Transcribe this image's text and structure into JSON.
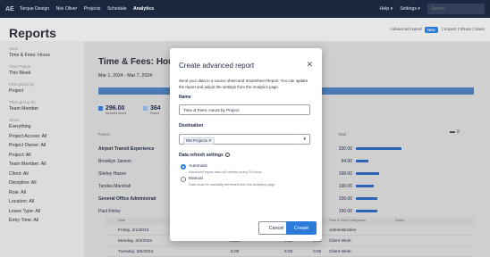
{
  "topnav": {
    "logo": "AE",
    "items": [
      "Torque Design",
      "Nivi Oliver",
      "Projects",
      "Schedule",
      "Analytics"
    ],
    "help": "Help ▾",
    "settings": "Settings ▾",
    "search_placeholder": "Search"
  },
  "page": {
    "title": "Reports",
    "advanced_report": "Advanced report",
    "new_badge": "New",
    "export": "Export",
    "share": "Share",
    "save": "Save"
  },
  "sidebar": {
    "view_label": "View",
    "view_value": "Time & Fees: Hours",
    "timeframe_label": "Time Frame",
    "timeframe_value": "This Week",
    "first_group_label": "First group by",
    "first_group_value": "Project",
    "then_group_label": "Then group by",
    "then_group_value": "Team Member",
    "show_label": "Show",
    "filters": [
      "Everything",
      "Project Access: All",
      "Project Owner: All",
      "Project: All",
      "Team Member: All",
      "Client: All",
      "Discipline: All",
      "Role: All",
      "Location: All",
      "Leave Type: All",
      "Entry Time: All"
    ]
  },
  "report": {
    "title": "Time & Fees: Hou",
    "date_range": "Mar 1, 2024 - Mar 7, 2024",
    "kpi1_value": "296.00",
    "kpi1_label": "Incurred hours",
    "kpi2_value": "364",
    "kpi2_label": "Future",
    "col_project": "Project",
    "col_total": "Total",
    "rows": [
      {
        "name": "Airport Transit Experience",
        "total": "330.00",
        "bold": true,
        "bar": 0.85
      },
      {
        "name": "Brooklyn Janson",
        "total": "94.00",
        "bold": false,
        "bar": 0.24
      },
      {
        "name": "Shirley Hason",
        "total": "168.00",
        "bold": false,
        "bar": 0.43
      },
      {
        "name": "Tamika Marshall",
        "total": "130.00",
        "bold": false,
        "bar": 0.33
      },
      {
        "name": "General Office Administrati",
        "total": "156.00",
        "bold": true,
        "bar": 0.4
      },
      {
        "name": "Paul Finley",
        "total": "156.00",
        "bold": false,
        "bar": 0.4
      }
    ],
    "detail_headers": [
      "Date",
      "Time & Fees Categories",
      "Notes"
    ],
    "detail_rows": [
      {
        "date": "Friday, 3/1/2024",
        "a": "4.00",
        "b": "4.00",
        "c": "0.00",
        "cat": "Administrative"
      },
      {
        "date": "Monday, 3/4/2024",
        "a": "8.00",
        "b": "8.00",
        "c": "0.00",
        "cat": "Client Work"
      },
      {
        "date": "Tuesday, 3/5/2024",
        "a": "8.00",
        "b": "8.00",
        "c": "0.00",
        "cat": "Client Work"
      }
    ]
  },
  "modal": {
    "title": "Create advanced report",
    "description": "Send your data to a source sheet and Smartsheet Report. You can update the report and adjust the settings from the Analytics page.",
    "name_label": "Name",
    "name_value": "Time & Fees: Hours by Project",
    "destination_label": "Destination",
    "destination_chip": "RM Projects ✕",
    "refresh_label": "Data refresh settings",
    "auto_label": "Automatic",
    "auto_sub": "Advanced report data will refresh every 24 hours",
    "manual_label": "Manual",
    "manual_sub": "Data must be manually refreshed from the Analytics page",
    "cancel": "Cancel",
    "create": "Create"
  },
  "colors": {
    "accent": "#2b7bd8",
    "nav": "#1c2740"
  }
}
